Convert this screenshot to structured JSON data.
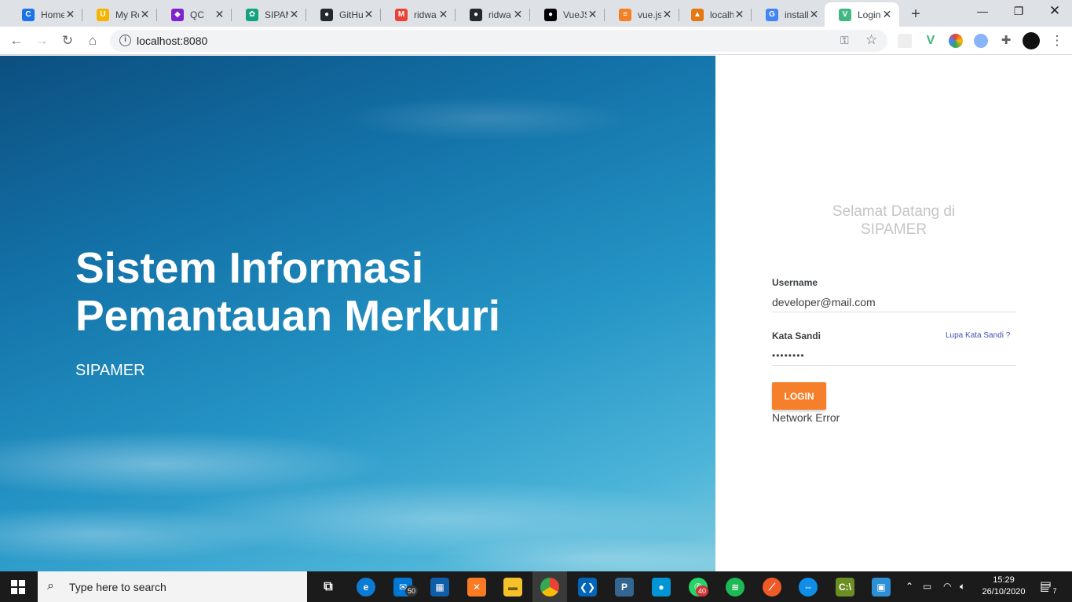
{
  "browser": {
    "tabs": [
      {
        "label": "Home",
        "favicon_color": "#1a73e8",
        "favicon_glyph": "C"
      },
      {
        "label": "My Re",
        "favicon_color": "#f5b400",
        "favicon_glyph": "U"
      },
      {
        "label": "QC",
        "favicon_color": "#7e22ce",
        "favicon_glyph": "◆"
      },
      {
        "label": "SIPAM",
        "favicon_color": "#11a37f",
        "favicon_glyph": "✿"
      },
      {
        "label": "GitHu",
        "favicon_color": "#24292e",
        "favicon_glyph": "●"
      },
      {
        "label": "ridwa",
        "favicon_color": "#ea4335",
        "favicon_glyph": "M"
      },
      {
        "label": "ridwa",
        "favicon_color": "#24292e",
        "favicon_glyph": "●"
      },
      {
        "label": "VueJS",
        "favicon_color": "#000000",
        "favicon_glyph": "●"
      },
      {
        "label": "vue.js",
        "favicon_color": "#f48024",
        "favicon_glyph": "≡"
      },
      {
        "label": "localh",
        "favicon_color": "#e47911",
        "favicon_glyph": "▲"
      },
      {
        "label": "install",
        "favicon_color": "#4285f4",
        "favicon_glyph": "G"
      },
      {
        "label": "Login",
        "favicon_color": "#41b883",
        "favicon_glyph": "V"
      }
    ],
    "active_tab_index": 11,
    "url": "localhost:8080"
  },
  "hero": {
    "title_line1": "Sistem Informasi",
    "title_line2": "Pemantauan Merkuri",
    "subtitle": "SIPAMER"
  },
  "login": {
    "welcome_line1": "Selamat Datang di",
    "welcome_line2": "SIPAMER",
    "username_label": "Username",
    "username_value": "developer@mail.com",
    "password_label": "Kata Sandi",
    "password_value": "••••••••",
    "forgot_label": "Lupa Kata Sandi ?",
    "login_button": "LOGIN",
    "error_message": "Network Error",
    "accent_color": "#f57f2a"
  },
  "taskbar": {
    "search_placeholder": "Type here to search",
    "mail_badge": "50",
    "whatsapp_badge": "40",
    "time": "15:29",
    "date": "26/10/2020",
    "notifications": "7"
  }
}
